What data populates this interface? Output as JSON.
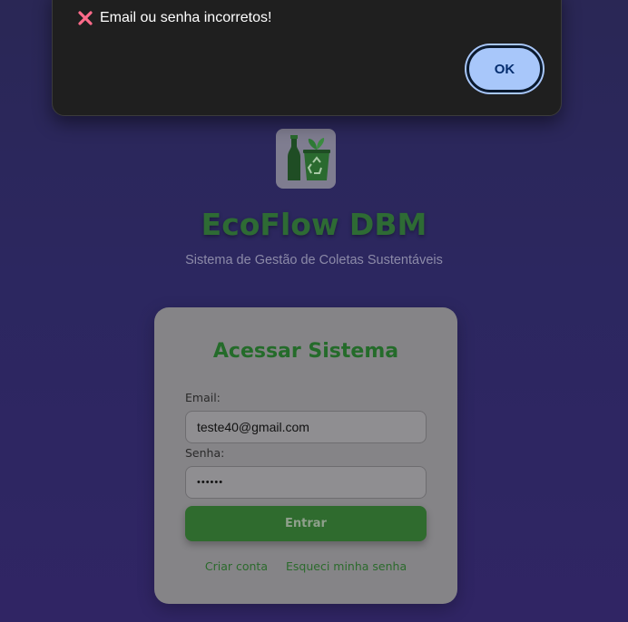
{
  "dialog": {
    "message": "Email ou senha incorretos!",
    "ok_label": "OK",
    "icon": "close-icon"
  },
  "brand": {
    "logo_icon": "recycle-bottle-icon",
    "name": "EcoFlow DBM",
    "tagline": "Sistema de Gestão de Coletas Sustentáveis"
  },
  "login": {
    "title": "Acessar Sistema",
    "email_label": "Email:",
    "email_value": "teste40@gmail.com",
    "password_label": "Senha:",
    "password_value": "••••••",
    "submit_label": "Entrar",
    "create_account_label": "Criar conta",
    "forgot_password_label": "Esqueci minha senha"
  },
  "colors": {
    "accent_green": "#2e6b34",
    "dialog_bg": "#1f1f1f",
    "ok_button": "#a8c7fa",
    "error_icon": "#ff6b8a"
  }
}
